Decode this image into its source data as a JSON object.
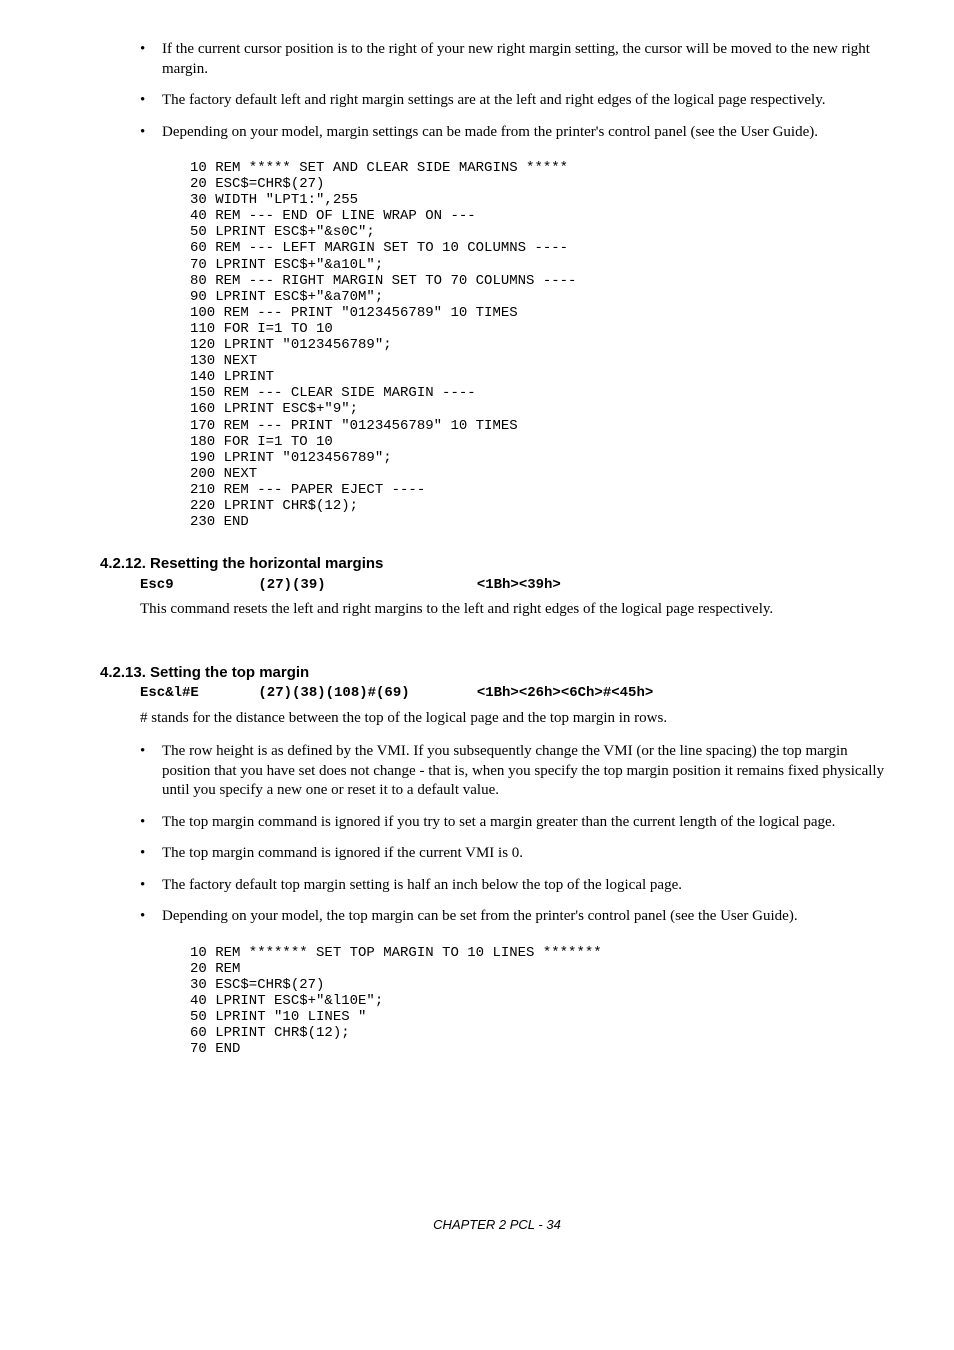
{
  "bullets_top": [
    "If the current cursor position is to the right of your new right margin setting, the cursor will be moved to the new right margin.",
    "The factory default left and right margin settings are at the left and right edges of the logical page respectively.",
    "Depending on your model,  margin settings can be made from the printer's control panel (see the User Guide)."
  ],
  "code_block_1": "10 REM ***** SET AND CLEAR SIDE MARGINS *****\n20 ESC$=CHR$(27)\n30 WIDTH \"LPT1:\",255\n40 REM --- END OF LINE WRAP ON ---\n50 LPRINT ESC$+\"&s0C\";\n60 REM --- LEFT MARGIN SET TO 10 COLUMNS ----\n70 LPRINT ESC$+\"&a10L\";\n80 REM --- RIGHT MARGIN SET TO 70 COLUMNS ----\n90 LPRINT ESC$+\"&a70M\";\n100 REM --- PRINT \"0123456789\" 10 TIMES\n110 FOR I=1 TO 10\n120 LPRINT \"0123456789\";\n130 NEXT\n140 LPRINT\n150 REM --- CLEAR SIDE MARGIN ----\n160 LPRINT ESC$+\"9\";\n170 REM --- PRINT \"0123456789\" 10 TIMES\n180 FOR I=1 TO 10\n190 LPRINT \"0123456789\";\n200 NEXT\n210 REM --- PAPER EJECT ----\n220 LPRINT CHR$(12);\n230 END",
  "section1": {
    "heading": "4.2.12.  Resetting the horizontal margins",
    "cmd": {
      "c1": "Esc9",
      "c2": "(27)(39)",
      "c3": "<1Bh><39h>"
    },
    "body": "This command resets the left and right margins to the left and right edges of the logical page respectively."
  },
  "section2": {
    "heading": "4.2.13.  Setting the top margin",
    "cmd": {
      "c1": "Esc&l#E",
      "c2": "(27)(38)(108)#(69)",
      "c3": "<1Bh><26h><6Ch>#<45h>"
    },
    "body": "# stands for the distance between the top of the logical page and the top margin in rows.",
    "bullets": [
      "The row height is as defined by the VMI. If you subsequently change the VMI (or the line spacing) the top margin position that you have set does not change - that is, when you specify the top margin position it remains fixed physically until you specify a new one or reset it to a default value.",
      "The top margin command is ignored if you try to set a margin greater than the current length of the logical page.",
      "The top margin command is ignored if the current VMI is 0.",
      "The factory default top margin setting is half an inch below the top of the logical page.",
      "Depending on your model,  the top margin can be set from the printer's control panel (see the User Guide)."
    ]
  },
  "code_block_2": "10 REM ******* SET TOP MARGIN TO 10 LINES *******\n20 REM\n30 ESC$=CHR$(27)\n40 LPRINT ESC$+\"&l10E\";\n50 LPRINT \"10 LINES \"\n60 LPRINT CHR$(12);\n70 END",
  "footer": "CHAPTER 2 PCL - 34"
}
